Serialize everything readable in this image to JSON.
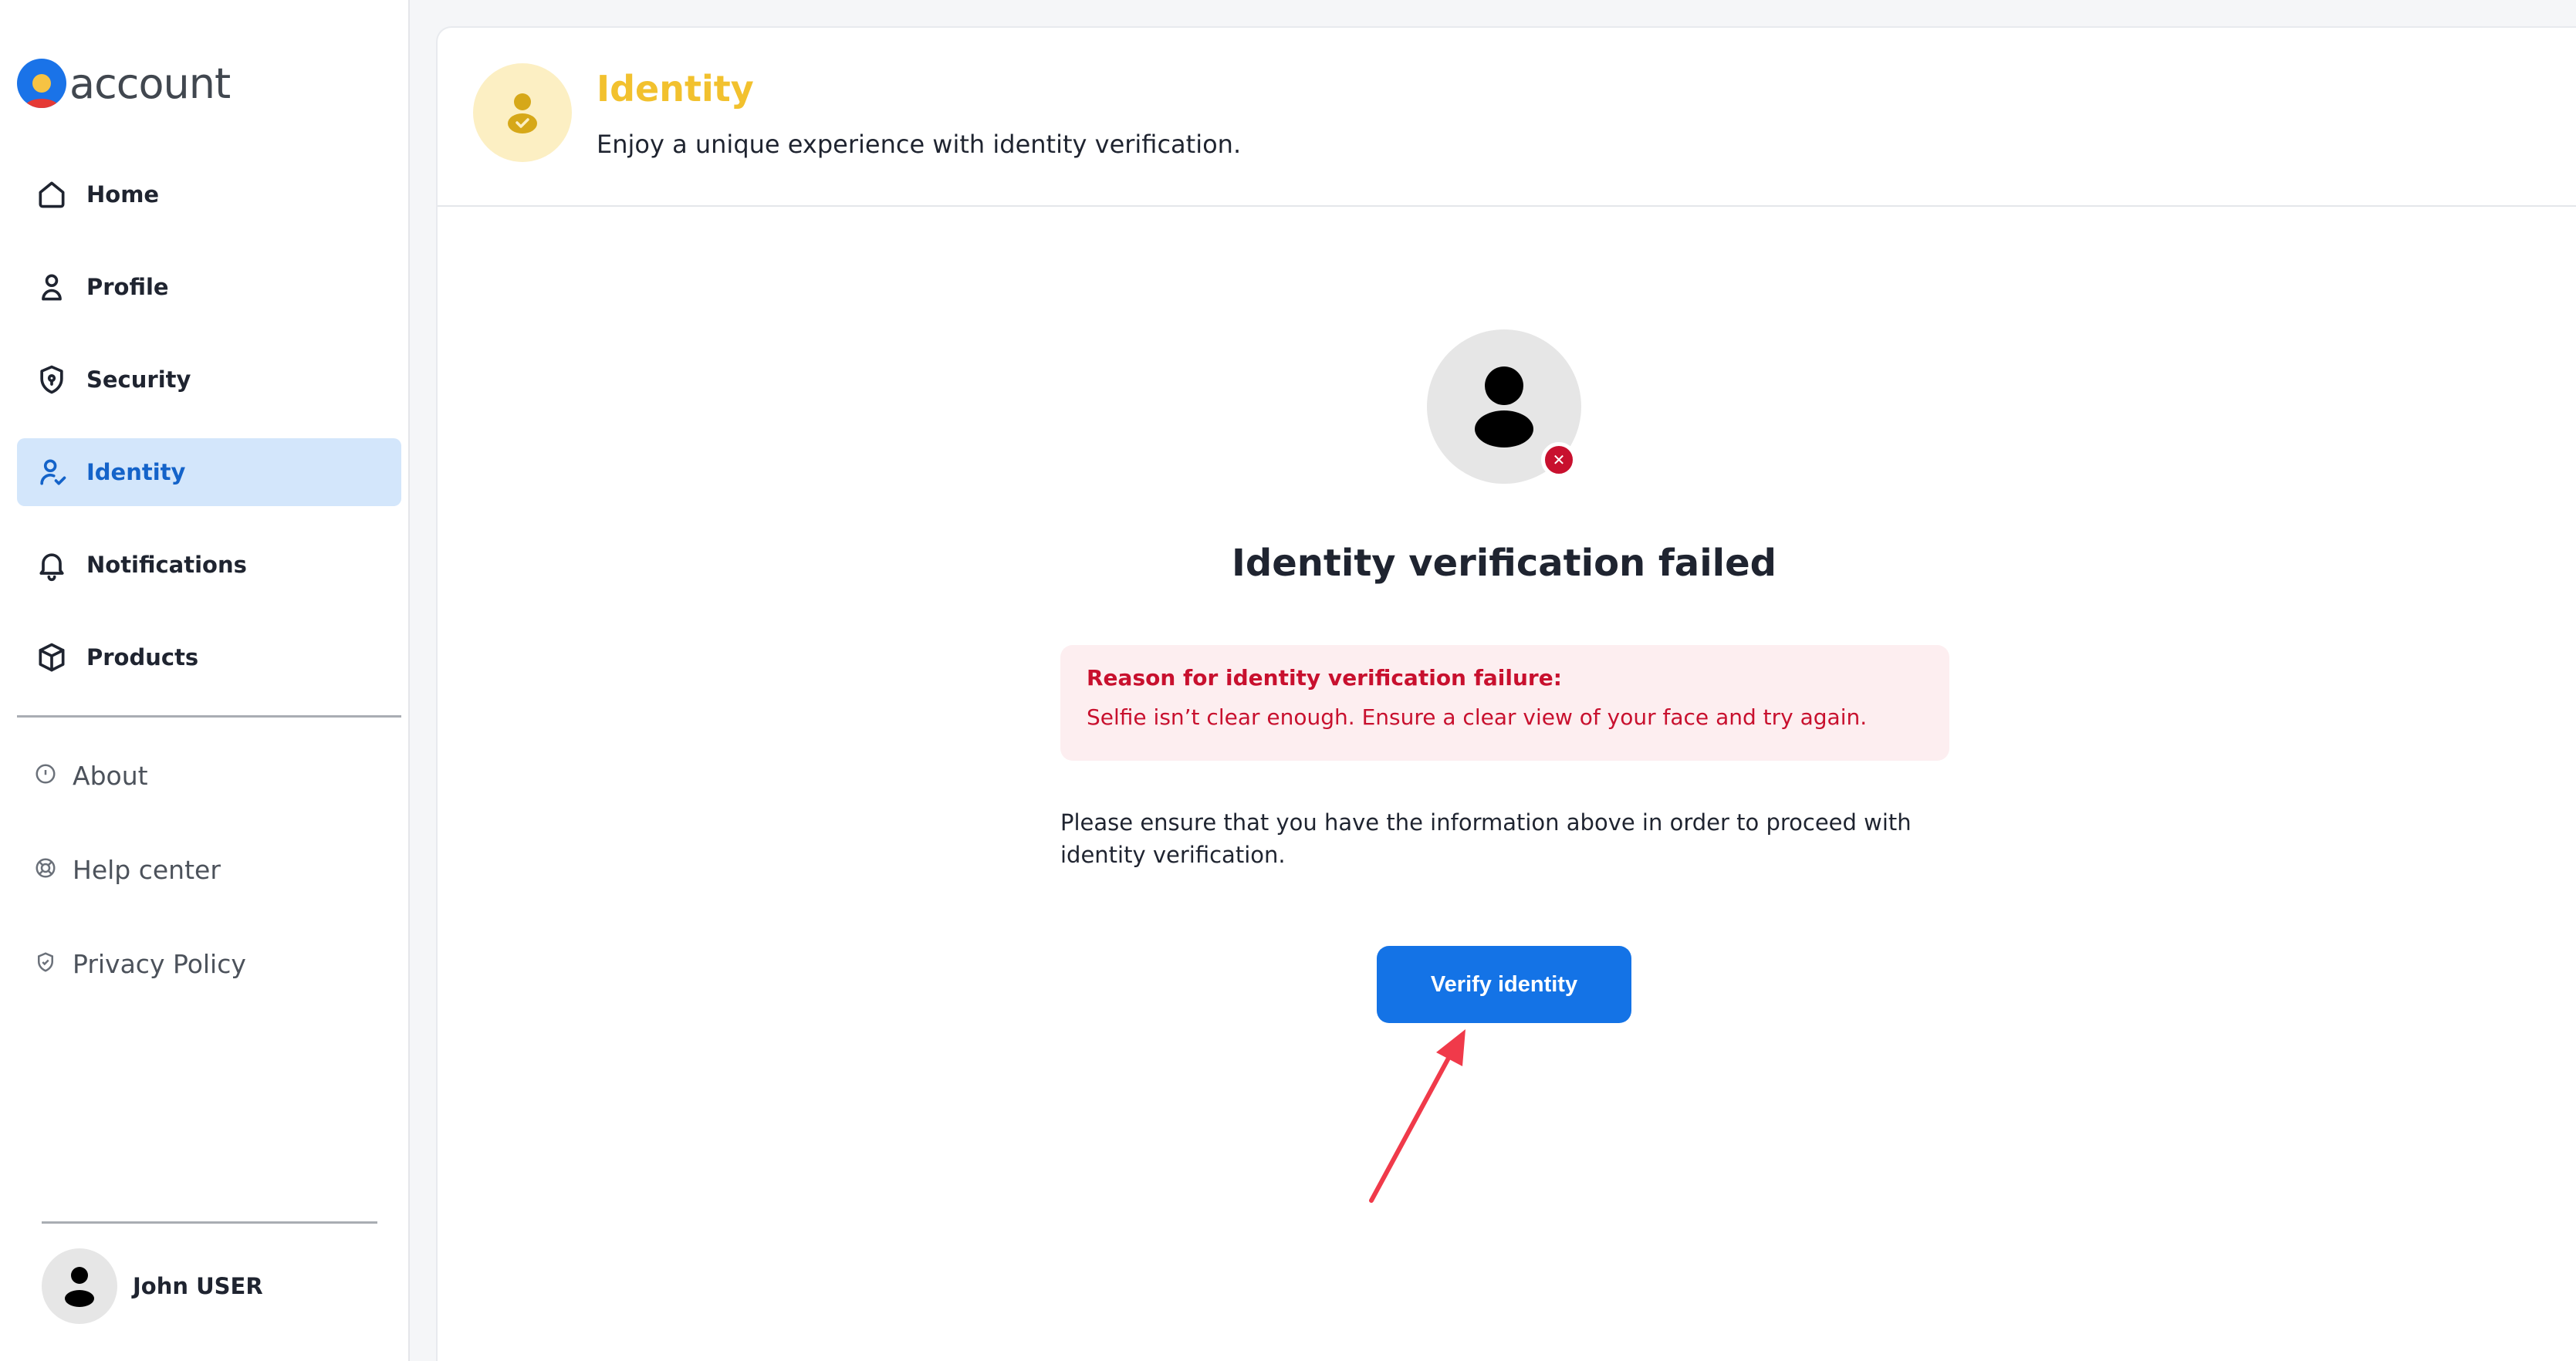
{
  "brand": {
    "logo_text": "account"
  },
  "sidebar": {
    "items": [
      {
        "label": "Home",
        "icon": "home-icon"
      },
      {
        "label": "Profile",
        "icon": "person-icon"
      },
      {
        "label": "Security",
        "icon": "shield-lock-icon"
      },
      {
        "label": "Identity",
        "icon": "identity-icon",
        "active": true
      },
      {
        "label": "Notifications",
        "icon": "bell-icon"
      },
      {
        "label": "Products",
        "icon": "box-icon"
      }
    ],
    "secondary": [
      {
        "label": "About",
        "icon": "info-icon"
      },
      {
        "label": "Help center",
        "icon": "lifebuoy-icon"
      },
      {
        "label": "Privacy Policy",
        "icon": "shield-check-icon"
      }
    ],
    "user": {
      "name": "John USER"
    }
  },
  "header": {
    "title": "Identity",
    "subtitle": "Enjoy a unique experience with identity verification."
  },
  "status": {
    "title": "Identity verification failed",
    "reason_title": "Reason for identity verification failure:",
    "reason_text": "Selfie isn’t clear enough. Ensure a clear view of your face and try again.",
    "info": "Please ensure that you have the information above in order to proceed with identity verification.",
    "button_label": "Verify identity"
  },
  "colors": {
    "accent": "#1473e6",
    "active_bg": "#d3e6fb",
    "header_title": "#f2c12e",
    "error": "#c8102e",
    "error_bg": "#fdeef0",
    "annotation_arrow": "#f03a4a"
  }
}
